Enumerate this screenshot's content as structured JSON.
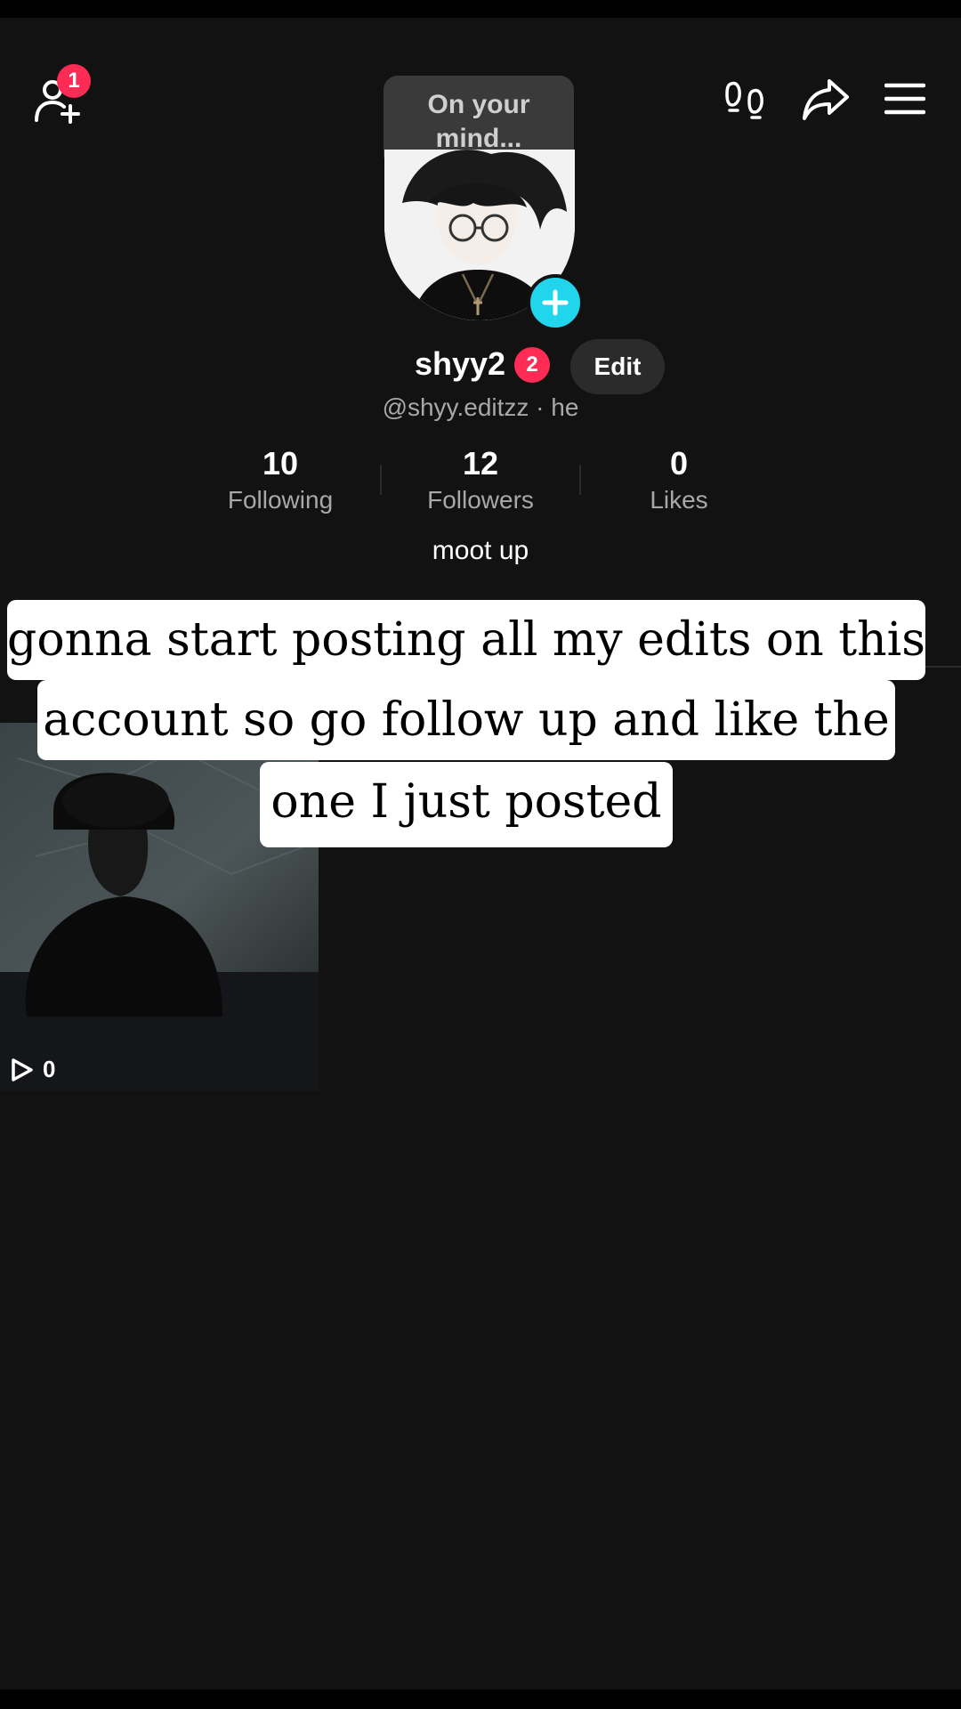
{
  "header": {
    "add_friends_badge": "1",
    "thought_bubble": "On your mind...",
    "icons": [
      "add-friends-icon",
      "footprints-icon",
      "share-icon",
      "menu-icon"
    ]
  },
  "profile": {
    "display_name": "shyy2",
    "name_badge": "2",
    "edit_label": "Edit",
    "handle": "@shyy.editzz · he",
    "bio": "moot up"
  },
  "stats": [
    {
      "value": "10",
      "label": "Following"
    },
    {
      "value": "12",
      "label": "Followers"
    },
    {
      "value": "0",
      "label": "Likes"
    }
  ],
  "caption": {
    "lines": [
      "gonna start posting all my edits on this",
      "account so go follow up and like the",
      "one I just posted"
    ]
  },
  "videos": [
    {
      "views": "0"
    }
  ],
  "colors": {
    "background": "#121212",
    "badge": "#fe2c55",
    "accent": "#20d5ec"
  }
}
